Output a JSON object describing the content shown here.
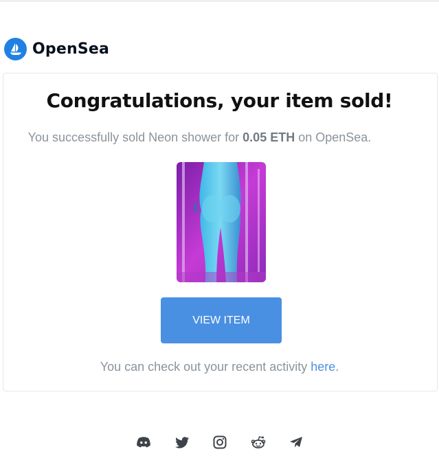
{
  "brand": {
    "name": "OpenSea",
    "logo_icon": "opensea-ship-icon",
    "color": "#2081e2"
  },
  "headline": "Congratulations, your item sold!",
  "message": {
    "prefix": "You successfully sold Neon shower for ",
    "price": "0.05 ETH",
    "suffix": " on OpenSea."
  },
  "item": {
    "image_icon": "nft-artwork-image"
  },
  "button": {
    "label": "VIEW ITEM",
    "color": "#4a90e2"
  },
  "activity": {
    "prefix": "You can check out your recent activity ",
    "link": "here",
    "suffix": "."
  },
  "footer": {
    "socials": [
      "discord-icon",
      "twitter-icon",
      "instagram-icon",
      "reddit-icon",
      "telegram-icon"
    ]
  }
}
